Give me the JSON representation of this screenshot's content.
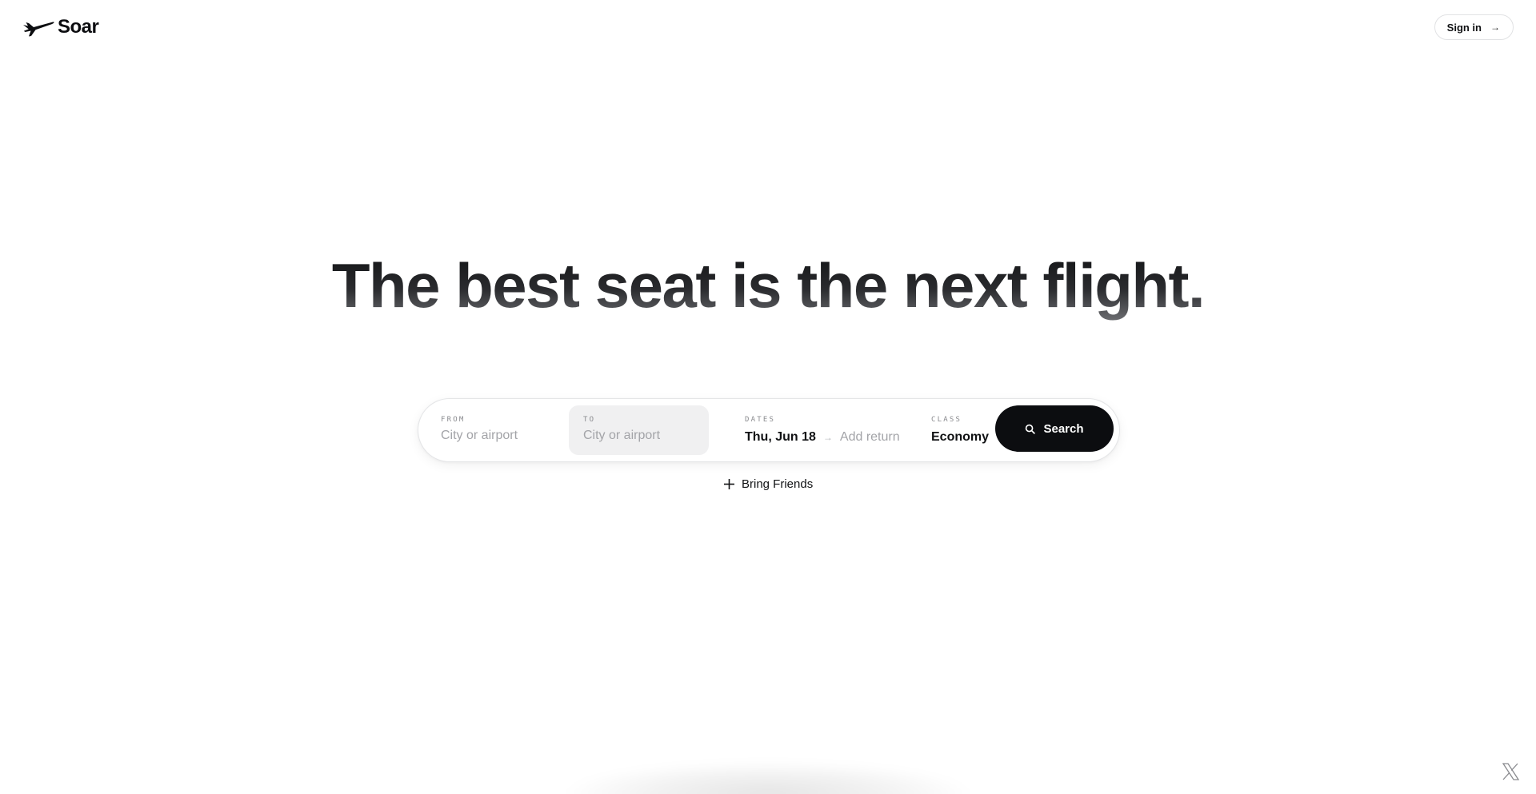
{
  "header": {
    "logo_text": "Soar",
    "logo_icon": "airplane-icon",
    "signin_label": "Sign in",
    "signin_icon": "arrow-right-icon"
  },
  "hero": {
    "headline": "The best seat is the next flight."
  },
  "search": {
    "from": {
      "label": "FROM",
      "placeholder": "City or airport",
      "value": ""
    },
    "to": {
      "label": "TO",
      "placeholder": "City or airport",
      "value": ""
    },
    "dates": {
      "label": "DATES",
      "start": "Thu, Jun 18",
      "separator": "→",
      "return_placeholder": "Add return"
    },
    "class": {
      "label": "CLASS",
      "value": "Economy"
    },
    "button_label": "Search",
    "button_icon": "search-icon"
  },
  "bring_friends": {
    "label": "Bring Friends",
    "icon": "plus-icon"
  },
  "social": {
    "icon": "x-logo-icon"
  },
  "colors": {
    "primary": "#0c0d10",
    "to_field_bg": "#f0f0f1",
    "placeholder": "#a3a4a8"
  }
}
